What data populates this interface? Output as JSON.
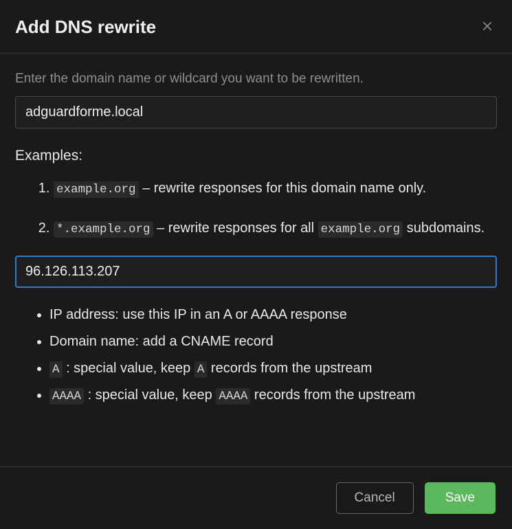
{
  "header": {
    "title": "Add DNS rewrite"
  },
  "body": {
    "instruction": "Enter the domain name or wildcard you want to be rewritten.",
    "domain_input_value": "adguardforme.local",
    "examples_heading": "Examples:",
    "examples": [
      {
        "code": "example.org",
        "text_after": " – rewrite responses for this domain name only."
      },
      {
        "code": "*.example.org",
        "text_after": " – rewrite responses for all ",
        "code2": "example.org",
        "tail": " subdomains."
      }
    ],
    "ip_input_value": "96.126.113.207",
    "bullets": [
      {
        "text": "IP address: use this IP in an A or AAAA response"
      },
      {
        "text": "Domain name: add a CNAME record"
      },
      {
        "code": "A",
        "mid": " : special value, keep ",
        "code2": "A",
        "tail": " records from the upstream"
      },
      {
        "code": "AAAA",
        "mid": " : special value, keep ",
        "code2": "AAAA",
        "tail": " records from the upstream"
      }
    ]
  },
  "footer": {
    "cancel_label": "Cancel",
    "save_label": "Save"
  }
}
